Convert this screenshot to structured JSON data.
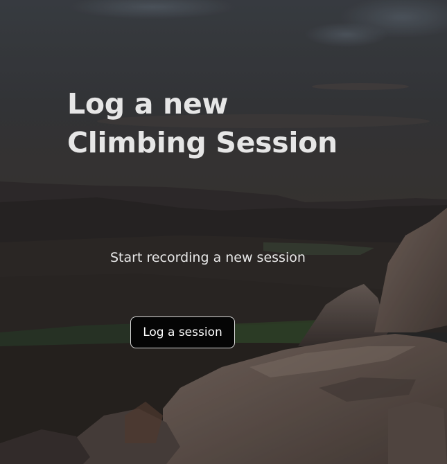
{
  "hero": {
    "title_line1": "Log a new",
    "title_line2": "Climbing Session"
  },
  "subtitle": "Start recording a new session",
  "action": {
    "button_label": "Log a session"
  },
  "colors": {
    "text": "#e6e6e6",
    "button_bg": "#050505",
    "button_border": "#d8d8d8"
  }
}
